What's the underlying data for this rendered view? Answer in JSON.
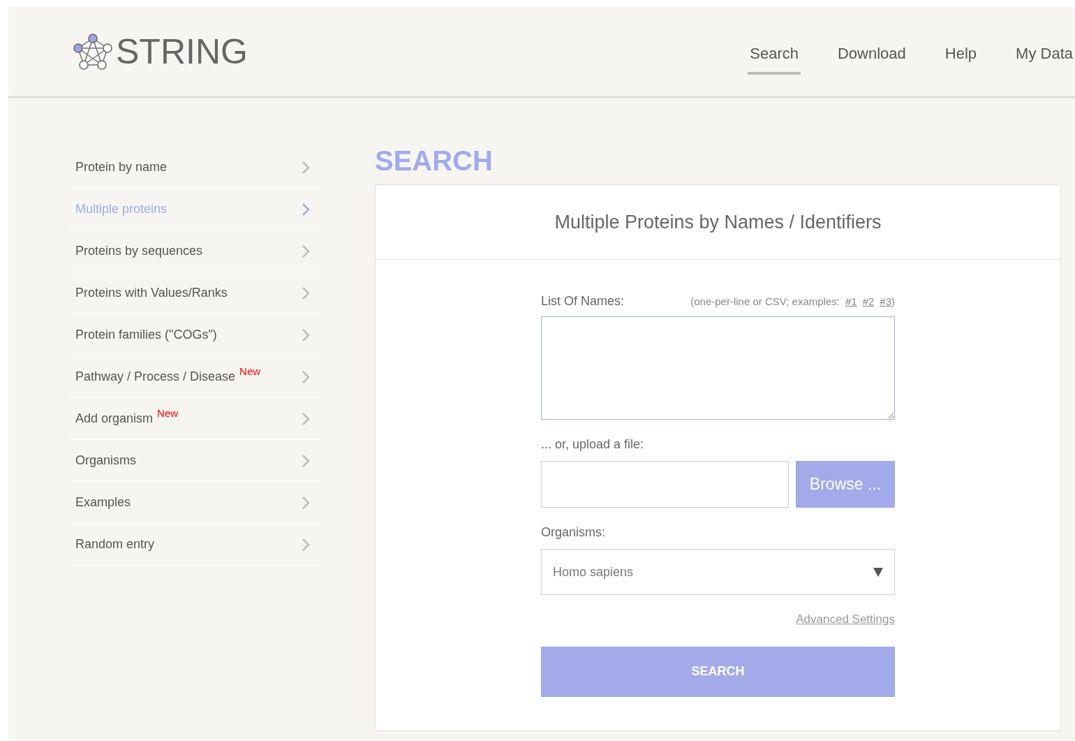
{
  "logo": {
    "text": "STRING"
  },
  "nav": [
    {
      "label": "Search",
      "selected": true
    },
    {
      "label": "Download",
      "selected": false
    },
    {
      "label": "Help",
      "selected": false
    },
    {
      "label": "My Data",
      "selected": false
    }
  ],
  "sidebar": {
    "items": [
      {
        "label": "Protein by name",
        "selected": false
      },
      {
        "label": "Multiple proteins",
        "selected": true
      },
      {
        "label": "Proteins by sequences",
        "selected": false
      },
      {
        "label": "Proteins with Values/Ranks",
        "selected": false
      },
      {
        "label": "Protein families (\"COGs\")",
        "selected": false
      },
      {
        "label": "Pathway / Process / Disease",
        "selected": false,
        "badge": "New"
      },
      {
        "label": "Add organism",
        "selected": false,
        "badge": "New"
      },
      {
        "label": "Organisms",
        "selected": false
      },
      {
        "label": "Examples",
        "selected": false
      },
      {
        "label": "Random entry",
        "selected": false
      }
    ]
  },
  "page_title": "SEARCH",
  "panel": {
    "title": "Multiple Proteins by Names / Identifiers",
    "names_label": "List Of Names:",
    "names_hint": "(one-per-line or CSV; examples:",
    "examples": [
      "#1",
      "#2",
      "#3"
    ],
    "names_hint_end": ")",
    "upload_label": "... or, upload a file:",
    "browse_button": "Browse ...",
    "organisms_label": "Organisms:",
    "organism_value": "Homo sapiens",
    "advanced_link": "Advanced Settings",
    "search_button": "SEARCH"
  }
}
